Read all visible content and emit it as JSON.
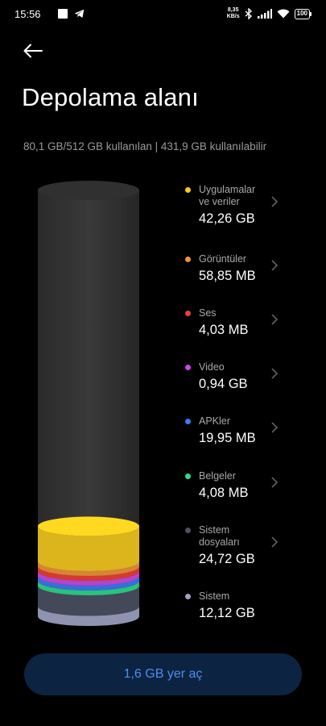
{
  "status_bar": {
    "time": "15:56",
    "net_speed_value": "8,35",
    "net_speed_unit": "KB/s",
    "battery": "100",
    "icons": [
      "square-app-icon",
      "telegram-icon",
      "bluetooth-icon",
      "signal-icon",
      "wifi-icon",
      "battery-icon"
    ]
  },
  "header": {
    "back_icon": "arrow-left-icon",
    "title": "Depolama alanı"
  },
  "summary": {
    "text": "80,1 GB/512 GB kullanılan | 431,9 GB kullanılabilir"
  },
  "storage": {
    "used_gb": 80.1,
    "total_gb": 512,
    "categories": [
      {
        "label_lines": [
          "Uygulamalar",
          "ve veriler"
        ],
        "value": "42,26 GB",
        "color": "#f4c91f",
        "gb": 42.26,
        "has_chevron": true
      },
      {
        "label_lines": [
          "Görüntüler"
        ],
        "value": "58,85 MB",
        "color": "#f0933a",
        "gb": 0.0589,
        "has_chevron": true
      },
      {
        "label_lines": [
          "Ses"
        ],
        "value": "4,03 MB",
        "color": "#ee3f37",
        "gb": 0.0039,
        "has_chevron": true
      },
      {
        "label_lines": [
          "Video"
        ],
        "value": "0,94 GB",
        "color": "#c84ae4",
        "gb": 0.94,
        "has_chevron": true
      },
      {
        "label_lines": [
          "APKler"
        ],
        "value": "19,95 MB",
        "color": "#3d7bf0",
        "gb": 0.0195,
        "has_chevron": true
      },
      {
        "label_lines": [
          "Belgeler"
        ],
        "value": "4,08 MB",
        "color": "#2fd98b",
        "gb": 0.004,
        "has_chevron": true
      },
      {
        "label_lines": [
          "Sistem",
          "dosyaları"
        ],
        "value": "24,72 GB",
        "color": "#4c5163",
        "gb": 24.72,
        "has_chevron": true
      },
      {
        "label_lines": [
          "Sistem"
        ],
        "value": "12,12 GB",
        "color": "#9ea3c4",
        "gb": 12.12,
        "has_chevron": false
      }
    ]
  },
  "actions": {
    "free_space_label": "1,6 GB yer aç"
  }
}
